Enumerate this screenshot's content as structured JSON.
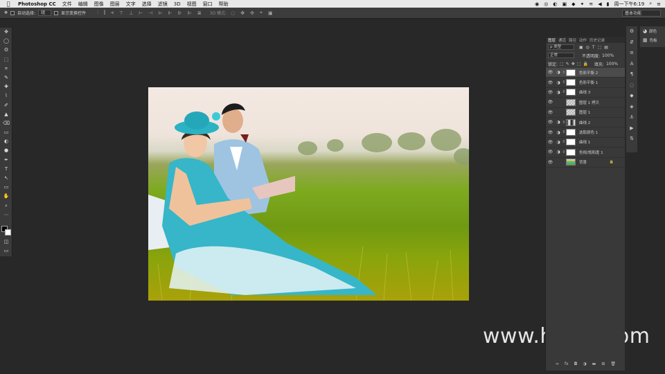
{
  "menubar": {
    "apple": "",
    "app": "Photoshop CC",
    "items": [
      "文件",
      "编辑",
      "图像",
      "图层",
      "文字",
      "选择",
      "滤镜",
      "3D",
      "视图",
      "窗口",
      "帮助"
    ],
    "clock": "周一下午6:19",
    "status_icons": [
      "◉",
      "◎",
      "◐",
      "▣",
      "◆",
      "✦",
      "≋",
      "◀",
      "▮",
      "⌕",
      "≡"
    ]
  },
  "optbar": {
    "move_icon": "✥",
    "auto_select_label": "自动选择:",
    "auto_select_value": "组",
    "show_transform_label": "显示变换控件",
    "three_d_label": "3D 模式:",
    "align_icons": [
      "⫶",
      "⫿",
      "⫷",
      "⊤",
      "⊥",
      "⊢",
      "⊣",
      "⊨",
      "⊩",
      "⊪",
      "⊫",
      "≣"
    ],
    "three_d_icons": [
      "◌",
      "✥",
      "✣",
      "⌖",
      "▣"
    ],
    "workspace": "基本功能"
  },
  "tools": [
    "✥",
    "◯",
    "ʘ",
    "⬚",
    "⌗",
    "✎",
    "✚",
    "⌇",
    "✐",
    "▲",
    "⌫",
    "▭",
    "◐",
    "●",
    "✒",
    "T",
    "↖",
    "▭",
    "✋",
    "⌕",
    "⋯"
  ],
  "layers_panel": {
    "tabs": [
      "图层",
      "通道",
      "路径",
      "动作",
      "历史记录"
    ],
    "filter_label": "ρ 类型",
    "filter_icons": [
      "▣",
      "◎",
      "T",
      "⬚",
      "▤"
    ],
    "blend_mode": "正常",
    "opacity_label": "不透明度:",
    "opacity_value": "100%",
    "lock_label": "锁定:",
    "lock_icons": [
      "⬚",
      "✎",
      "✥",
      "⬚",
      "🔒"
    ],
    "fill_label": "填充:",
    "fill_value": "100%",
    "layers": [
      {
        "name": "色彩平衡 2",
        "kind": "adjustment",
        "thumb": "mask",
        "selected": true
      },
      {
        "name": "色彩平衡 1",
        "kind": "adjustment",
        "thumb": "mask",
        "selected": false
      },
      {
        "name": "曲线 3",
        "kind": "adjustment",
        "thumb": "mask",
        "selected": false
      },
      {
        "name": "图层 1 拷贝",
        "kind": "pixel",
        "thumb": "check",
        "selected": false
      },
      {
        "name": "图层 1",
        "kind": "pixel",
        "thumb": "check",
        "selected": false
      },
      {
        "name": "曲线 2",
        "kind": "adjustment",
        "thumb": "dark",
        "selected": false
      },
      {
        "name": "选取颜色 1",
        "kind": "adjustment",
        "thumb": "mask",
        "selected": false
      },
      {
        "name": "曲线 1",
        "kind": "adjustment",
        "thumb": "mask",
        "selected": false
      },
      {
        "name": "色相/饱和度 1",
        "kind": "adjustment",
        "thumb": "mask",
        "selected": false
      },
      {
        "name": "背景",
        "kind": "background",
        "thumb": "photo",
        "selected": false
      }
    ],
    "bottom_icons": [
      "∞",
      "fx",
      "◘",
      "◑",
      "▬",
      "⊞",
      "🗑"
    ]
  },
  "strip": [
    "⚙",
    "⇵",
    "≡",
    "A",
    "¶",
    "◌",
    "◆",
    "◈",
    "⚓",
    "▶",
    "⇅"
  ],
  "color_panel": {
    "items": [
      {
        "icon": "◕",
        "label": "颜色"
      },
      {
        "icon": "▦",
        "label": "色板"
      }
    ]
  },
  "watermark": "www.hunls.com"
}
